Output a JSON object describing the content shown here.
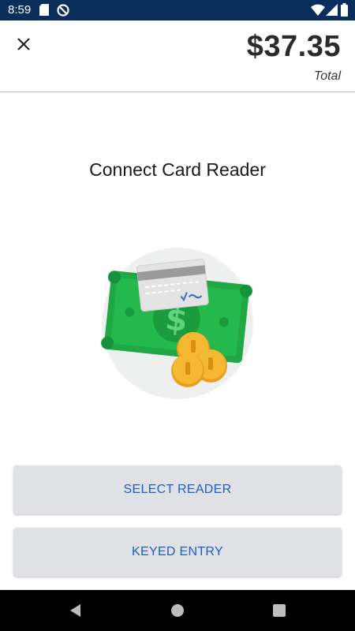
{
  "status_bar": {
    "time": "8:59",
    "icons": [
      "sd-card-icon",
      "do-not-disturb-icon",
      "wifi-icon",
      "signal-icon",
      "battery-icon"
    ]
  },
  "header": {
    "close_icon": "close-icon",
    "total_amount": "$37.35",
    "total_label": "Total"
  },
  "main": {
    "title": "Connect Card Reader",
    "illustration": "cash-card-coins-illustration"
  },
  "actions": {
    "select_reader": "SELECT READER",
    "keyed_entry": "KEYED ENTRY"
  },
  "nav_bar": {
    "icons": [
      "back-icon",
      "home-icon",
      "recents-icon"
    ]
  },
  "colors": {
    "status_bar": "#0a2e5c",
    "button_bg": "#dfe1e4",
    "button_text": "#1d5fc2",
    "money_green": "#1fa843",
    "coin_gold": "#f5b833"
  }
}
